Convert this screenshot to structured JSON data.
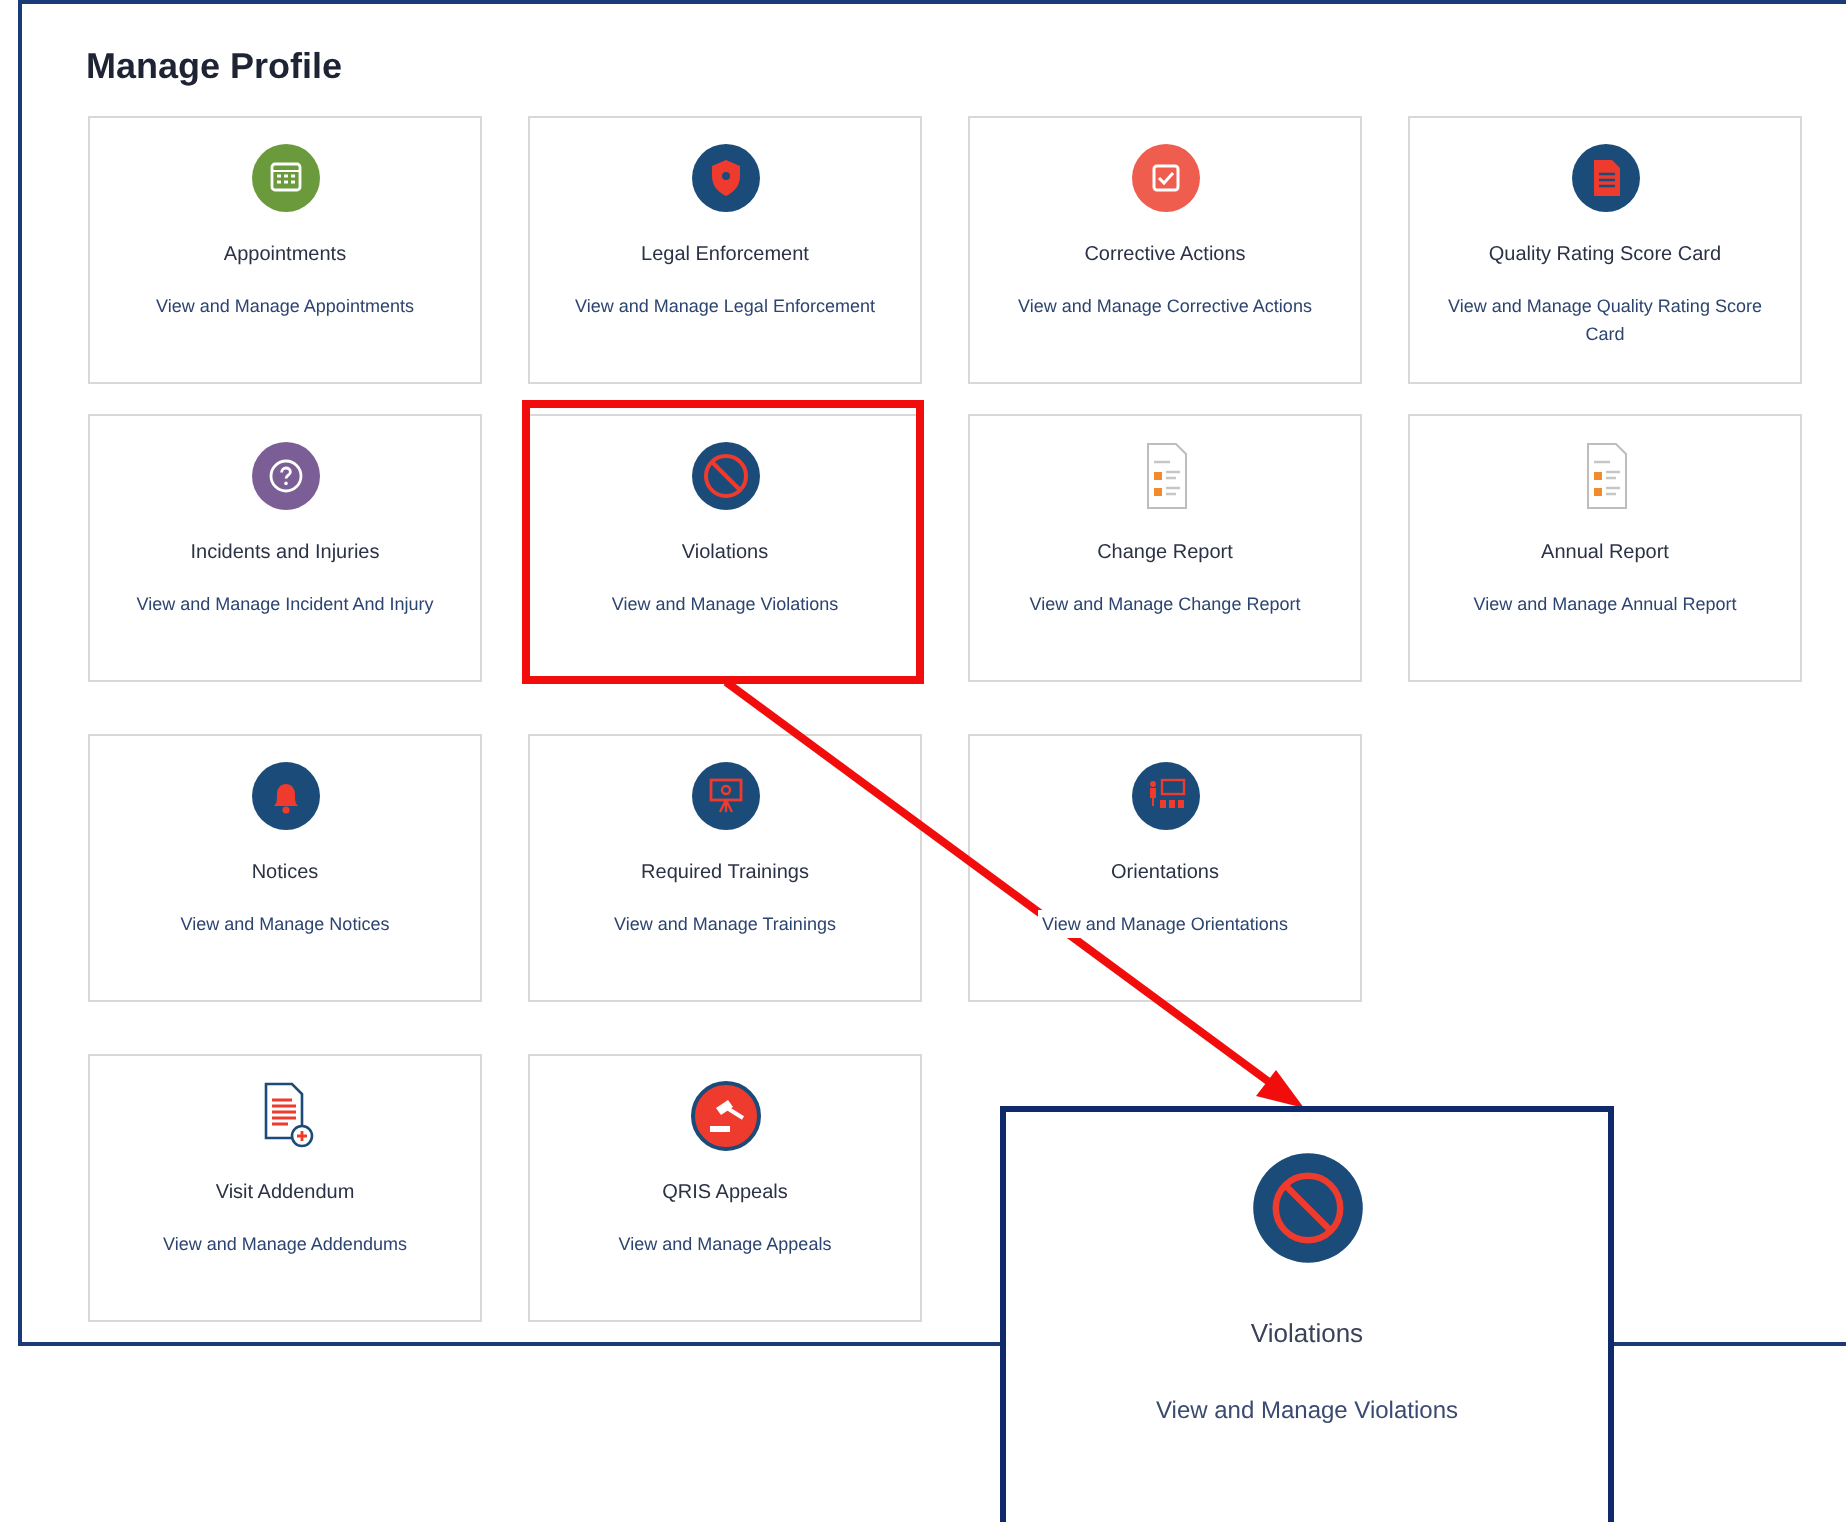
{
  "title": "Manage Profile",
  "rows": [
    {
      "cards": [
        {
          "kind": "calendar",
          "title": "Appointments",
          "subtitle": "View and Manage Appointments",
          "highlighted": false
        },
        {
          "kind": "shield",
          "title": "Legal Enforcement",
          "subtitle": "View and Manage Legal Enforcement",
          "highlighted": false
        },
        {
          "kind": "check",
          "title": "Corrective Actions",
          "subtitle": "View and Manage Corrective Actions",
          "highlighted": false
        },
        {
          "kind": "scorecard",
          "title": "Quality Rating Score Card",
          "subtitle": "View and Manage Quality Rating Score Card",
          "highlighted": false
        }
      ]
    },
    {
      "cards": [
        {
          "kind": "question",
          "title": "Incidents and Injuries",
          "subtitle": "View and Manage Incident And Injury",
          "highlighted": false
        },
        {
          "kind": "ban",
          "title": "Violations",
          "subtitle": "View and Manage Violations",
          "highlighted": true
        },
        {
          "kind": "report",
          "title": "Change Report",
          "subtitle": "View and Manage Change Report",
          "highlighted": false
        },
        {
          "kind": "report",
          "title": "Annual Report",
          "subtitle": "View and Manage Annual Report",
          "highlighted": false
        }
      ]
    },
    {
      "cards": [
        {
          "kind": "bell",
          "title": "Notices",
          "subtitle": "View and Manage Notices",
          "highlighted": false
        },
        {
          "kind": "easel",
          "title": "Required Trainings",
          "subtitle": "View and Manage Trainings",
          "highlighted": false
        },
        {
          "kind": "classroom",
          "title": "Orientations",
          "subtitle": "View and Manage Orientations",
          "highlighted": false
        }
      ]
    },
    {
      "cards": [
        {
          "kind": "addendum",
          "title": "Visit Addendum",
          "subtitle": "View and Manage Addendums",
          "highlighted": false
        },
        {
          "kind": "gavel",
          "title": "QRIS Appeals",
          "subtitle": "View and Manage Appeals",
          "highlighted": false
        }
      ]
    }
  ],
  "callout": {
    "kind": "ban",
    "title": "Violations",
    "subtitle": "View and Manage Violations"
  }
}
